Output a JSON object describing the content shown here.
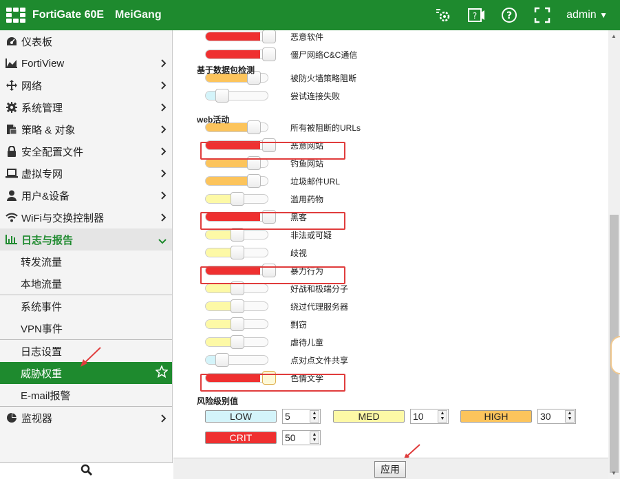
{
  "topbar": {
    "brand": "FortiGate 60E",
    "hostname": "MeiGang",
    "admin": "admin"
  },
  "sidebar": {
    "items": [
      {
        "label": "仪表板",
        "icon": "dashboard-icon",
        "chev": false
      },
      {
        "label": "FortiView",
        "icon": "chart-icon",
        "chev": true
      },
      {
        "label": "网络",
        "icon": "network-move-icon",
        "chev": true
      },
      {
        "label": "系统管理",
        "icon": "gear-icon",
        "chev": true
      },
      {
        "label": "策略 & 对象",
        "icon": "policy-icon",
        "chev": true
      },
      {
        "label": "安全配置文件",
        "icon": "lock-icon",
        "chev": true
      },
      {
        "label": "虚拟专网",
        "icon": "laptop-icon",
        "chev": true
      },
      {
        "label": "用户&设备",
        "icon": "user-icon",
        "chev": true
      },
      {
        "label": "WiFi与交换控制器",
        "icon": "wifi-icon",
        "chev": true
      }
    ],
    "log_group": "日志与报告",
    "log_sub": [
      "转发流量",
      "本地流量",
      "系统事件",
      "VPN事件",
      "日志设置",
      "威胁权重",
      "E-mail报警"
    ],
    "monitor": "监视器"
  },
  "threat": {
    "rows_top": [
      {
        "label": "恶意软件",
        "level": "critical"
      },
      {
        "label": "僵尸网络C&C通信",
        "level": "critical"
      }
    ],
    "section_packet": "基于数据包检测",
    "rows_packet": [
      {
        "label": "被防火墙策略阻断",
        "level": "high"
      },
      {
        "label": "尝试连接失败",
        "level": "low"
      }
    ],
    "section_web": "web活动",
    "rows_web": [
      {
        "label": "所有被阻断的URLs",
        "level": "high"
      },
      {
        "label": "恶意网站",
        "level": "critical"
      },
      {
        "label": "钓鱼网站",
        "level": "high"
      },
      {
        "label": "垃圾邮件URL",
        "level": "high"
      },
      {
        "label": "滥用药物",
        "level": "medium"
      },
      {
        "label": "黑客",
        "level": "critical"
      },
      {
        "label": "非法或可疑",
        "level": "medium"
      },
      {
        "label": "歧视",
        "level": "medium"
      },
      {
        "label": "暴力行为",
        "level": "critical"
      },
      {
        "label": "好战和极端分子",
        "level": "medium"
      },
      {
        "label": "绕过代理服务器",
        "level": "medium"
      },
      {
        "label": "剽窃",
        "level": "medium"
      },
      {
        "label": "虐待儿童",
        "level": "medium"
      },
      {
        "label": "点对点文件共享",
        "level": "low"
      },
      {
        "label": "色情文学",
        "level": "critical"
      }
    ],
    "section_risk": "风险级别值",
    "risk": {
      "low_label": "LOW",
      "low_value": "5",
      "med_label": "MED",
      "med_value": "10",
      "high_label": "HIGH",
      "high_value": "30",
      "crit_label": "CRIT",
      "crit_value": "50"
    },
    "apply": "应用"
  },
  "colors": {
    "accent": "#1e8a2e",
    "critical": "#ef3030",
    "high": "#fcc45c",
    "medium": "#fdf9a6",
    "low": "#d4f4fa",
    "highlight": "#e03c3c"
  }
}
